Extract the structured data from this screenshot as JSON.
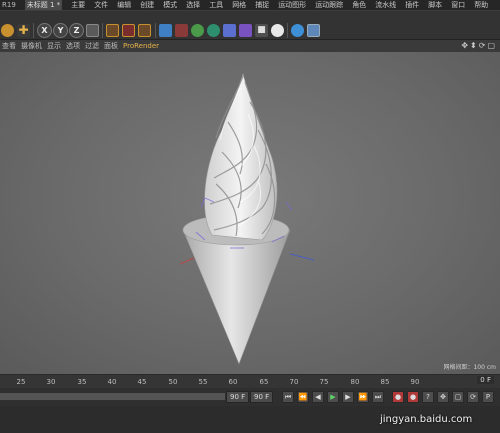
{
  "app": {
    "version": "R19",
    "document_tab": "未标题 1 *",
    "mode": "主要"
  },
  "menu": [
    "文件",
    "编辑",
    "创建",
    "模式",
    "选择",
    "工具",
    "网格",
    "捕捉",
    "运动图形",
    "运动跟踪",
    "角色",
    "流水线",
    "插件",
    "脚本",
    "窗口",
    "帮助"
  ],
  "toolbar": {
    "axis_x": "X",
    "axis_y": "Y",
    "axis_z": "Z"
  },
  "viewport_menu": [
    "查看",
    "摄像机",
    "显示",
    "选项",
    "过滤",
    "面板",
    "ProRender"
  ],
  "viewport": {
    "grid_info": "网格间距：100 cm"
  },
  "timeline": {
    "ticks": [
      "25",
      "30",
      "35",
      "40",
      "45",
      "50",
      "55",
      "60",
      "65",
      "70",
      "75",
      "80",
      "85",
      "90"
    ],
    "end_frame": "0 F"
  },
  "transport": {
    "frame_field": "90 F",
    "frame_field2": "90 F"
  },
  "watermark": "jingyan.baidu.com",
  "colors": {
    "accent": "#e4b24a",
    "background": "#3c3c3c",
    "viewport": "#6e6e6e"
  }
}
